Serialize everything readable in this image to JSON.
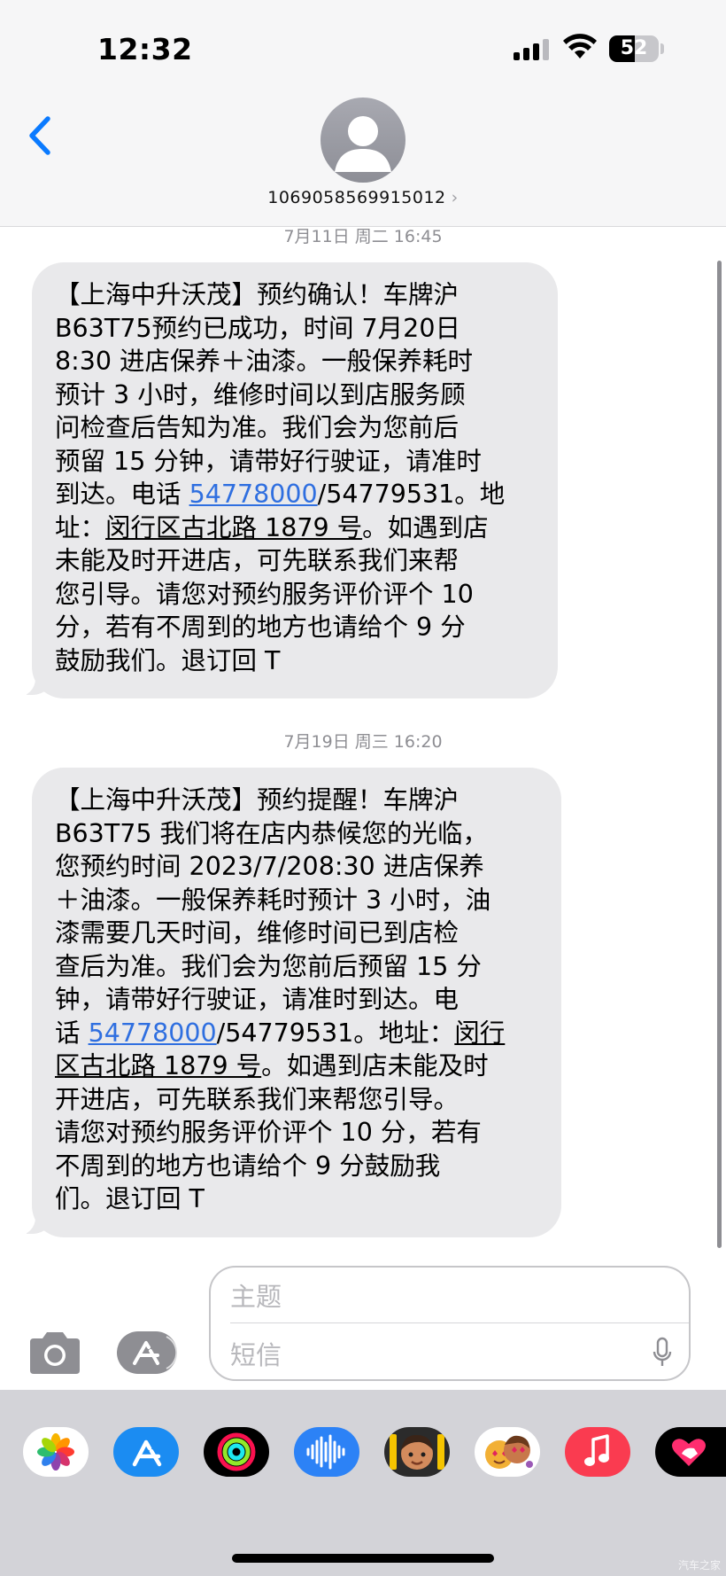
{
  "status": {
    "time": "12:32",
    "battery": "52"
  },
  "header": {
    "contact": "1069058569915012",
    "chevron": "›"
  },
  "messages": [
    {
      "timestamp": "7月11日 周二 16:45",
      "lines": [
        "【上海中升沃茂】预约确认！车牌沪",
        "B63T75预约已成功，时间 7月20日",
        "8:30 进店保养＋油漆。一般保养耗时",
        "预计 3 小时，维修时间以到店服务顾",
        "问检查后告知为准。我们会为您前后",
        "预留 15 分钟，请带好行驶证，请准时",
        "到达。电话 ",
        "址：",
        "未能及时开进店，可先联系我们来帮",
        "您引导。请您对预约服务评价评个 10",
        "分，若有不周到的地方也请给个 9 分",
        "鼓励我们。退订回 T"
      ],
      "phone_link": "54778000",
      "phone_rest": "/54779531。地",
      "address_link": "闵行区古北路 1879 号",
      "address_rest": "。如遇到店"
    },
    {
      "timestamp": "7月19日 周三 16:20",
      "lines": [
        "【上海中升沃茂】预约提醒！车牌沪",
        "B63T75 我们将在店内恭候您的光临，",
        "您预约时间 2023/7/208:30 进店保养",
        "＋油漆。一般保养耗时预计 3 小时，油",
        "漆需要几天时间，维修时间已到店检",
        "查后为准。我们会为您前后预留 15 分",
        "钟，请带好行驶证，请准时到达。电",
        "话 ",
        "区古北路 1879 号",
        "开进店，可先联系我们来帮您引导。",
        "请您对预约服务评价评个 10 分，若有",
        "不周到的地方也请给个 9 分鼓励我",
        "们。退订回 T"
      ],
      "phone_link": "54778000",
      "phone_rest": "/54779531。地址：",
      "address_link_1": "闵行",
      "address_rest": "。如遇到店未能及时"
    }
  ],
  "input": {
    "subject_placeholder": "主题",
    "text_placeholder": "短信"
  },
  "apps": [
    "photos-icon",
    "app-store-icon",
    "fitness-icon",
    "voice-memos-icon",
    "memoji-icon",
    "animoji-stickers-icon",
    "music-icon",
    "digital-touch-icon"
  ],
  "watermark": "汽车之家",
  "colors": {
    "bubble": "#e9e9eb",
    "link": "#2f6fe0",
    "ios_blue": "#0a7aff",
    "strip": "#d3d3d8"
  }
}
